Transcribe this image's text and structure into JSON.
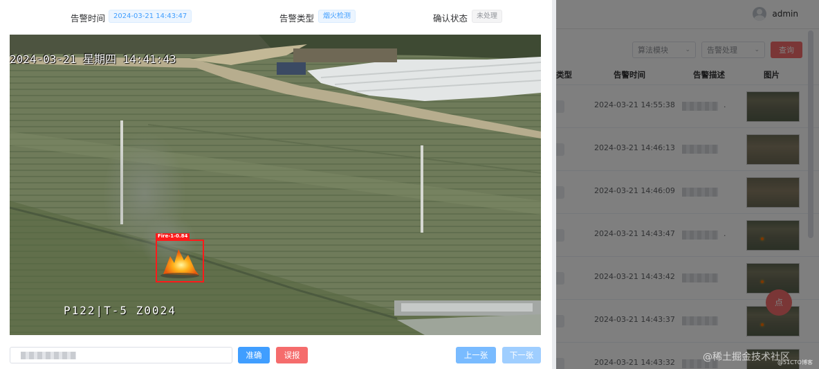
{
  "background": {
    "user": {
      "name": "admin"
    },
    "filters": {
      "algorithm_placeholder": "算法模块",
      "handling_placeholder": "告警处理",
      "search_label": "查询"
    },
    "table": {
      "columns": {
        "type_partial": "类型",
        "time": "告警时间",
        "desc": "告警描述",
        "image": "图片"
      },
      "rows": [
        {
          "time": "2024-03-21 14:55:38",
          "desc_tail": "."
        },
        {
          "time": "2024-03-21 14:46:13",
          "desc_tail": ""
        },
        {
          "time": "2024-03-21 14:46:09",
          "desc_tail": ""
        },
        {
          "time": "2024-03-21 14:43:47",
          "desc_tail": "."
        },
        {
          "time": "2024-03-21 14:43:42",
          "desc_tail": ""
        },
        {
          "time": "2024-03-21 14:43:37",
          "desc_tail": ""
        },
        {
          "time": "2024-03-21 14:43:32",
          "desc_tail": ""
        }
      ]
    },
    "float_button_label": "点"
  },
  "dialog": {
    "alert_time_label": "告警时间",
    "alert_time_value": "2024-03-21 14:43:47",
    "alert_type_label": "告警类型",
    "alert_type_value": "烟火检测",
    "confirm_status_label": "确认状态",
    "confirm_status_value": "未处理",
    "camera": {
      "timestamp": "2024-03-21 星期四 14:41:43",
      "camera_id": "P122|T-5  Z0024",
      "detection_label": "Fire-1-0.84"
    },
    "buttons": {
      "accurate": "准确",
      "false_alarm": "误报",
      "prev": "上一张",
      "next": "下一张"
    }
  },
  "watermark": "@稀土掘金技术社区",
  "watermark_small": "@51CTO博客",
  "colors": {
    "primary": "#409eff",
    "danger": "#f56c6c",
    "detection": "#ff1a1a"
  }
}
